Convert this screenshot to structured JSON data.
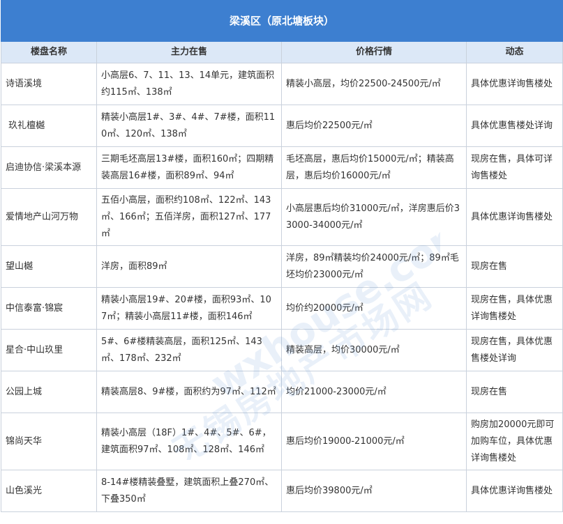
{
  "title": "梁溪区（原北塘板块）",
  "headers": [
    "楼盘名称",
    "主力在售",
    "价格行情",
    "动态"
  ],
  "rows": [
    {
      "name": "诗语溪境",
      "main": "小高层6、7、11、13、14单元，建筑面积约115㎡、138㎡",
      "price": "精装小高层，均价22500-24500元/㎡",
      "status": "具体优惠详询售楼处"
    },
    {
      "name": " 玖礼檀樾",
      "main": "精装小高层1#、3#、4#、7#楼，面积110㎡、120㎡、138㎡",
      "price": "惠后均价22500元/㎡",
      "status": "具体优惠售楼处详询"
    },
    {
      "name": "启迪协信·梁溪本源",
      "main": "三期毛坯高层13#楼，面积160㎡；四期精装高层16#楼，面积89㎡、94㎡",
      "price": "毛坯高层，惠后均价15000元/㎡；精装高层，惠后均价16000元/㎡",
      "status": "现房在售，具体可详询售楼处"
    },
    {
      "name": "爱情地产山河万物",
      "main": "五佰小高层，面积约108㎡、122㎡、143㎡、166㎡；五佰洋房，面积127㎡、177㎡",
      "price": "小高层惠后均价31000元/㎡，洋房惠后价33000-34000元/㎡",
      "status": "具体优惠详询售楼处"
    },
    {
      "name": "望山樾",
      "main": "洋房，面积89㎡",
      "price": "洋房，89㎡精装均价24000元/㎡；89㎡毛坯均价23000元/㎡",
      "status": "现房在售"
    },
    {
      "name": "中信泰富·锦宸",
      "main": "精装小高层19#、20#楼，面积93㎡、107㎡；精装小高层11#楼，面积146㎡",
      "price": "均价约20000元/㎡",
      "status": "现房在售，具体优惠详询售楼处"
    },
    {
      "name": "星合·中山玖里",
      "main": "5#、6#楼精装高层，面积125㎡、143㎡、178㎡、232㎡",
      "price": "精装高层，均价30000元/㎡",
      "status": "现房在售，具体优惠售楼处详询"
    },
    {
      "name": "公园上城",
      "main": "精装高层8、9#楼，面积约为97㎡、112㎡",
      "price": "均价21000-23000元/㎡",
      "status": "现房在售"
    },
    {
      "name": "锦尚天华",
      "main": "精装小高层（18F）1#、4#、5#、6#，建筑面积97㎡、108㎡、128㎡、146㎡",
      "price": "惠后均价19000-21000元/㎡",
      "status": "购房加20000元即可加购车位，具体优惠详询售楼处"
    },
    {
      "name": "山色溪光",
      "main": "8-14#楼精装叠墅，建筑面积上叠270㎡、下叠350㎡",
      "price": "惠后均价39800元/㎡",
      "status": "具体优惠详询售楼处"
    }
  ],
  "watermark": {
    "cn": "无锡房地产市场网",
    "en": "wxhouse.com"
  }
}
